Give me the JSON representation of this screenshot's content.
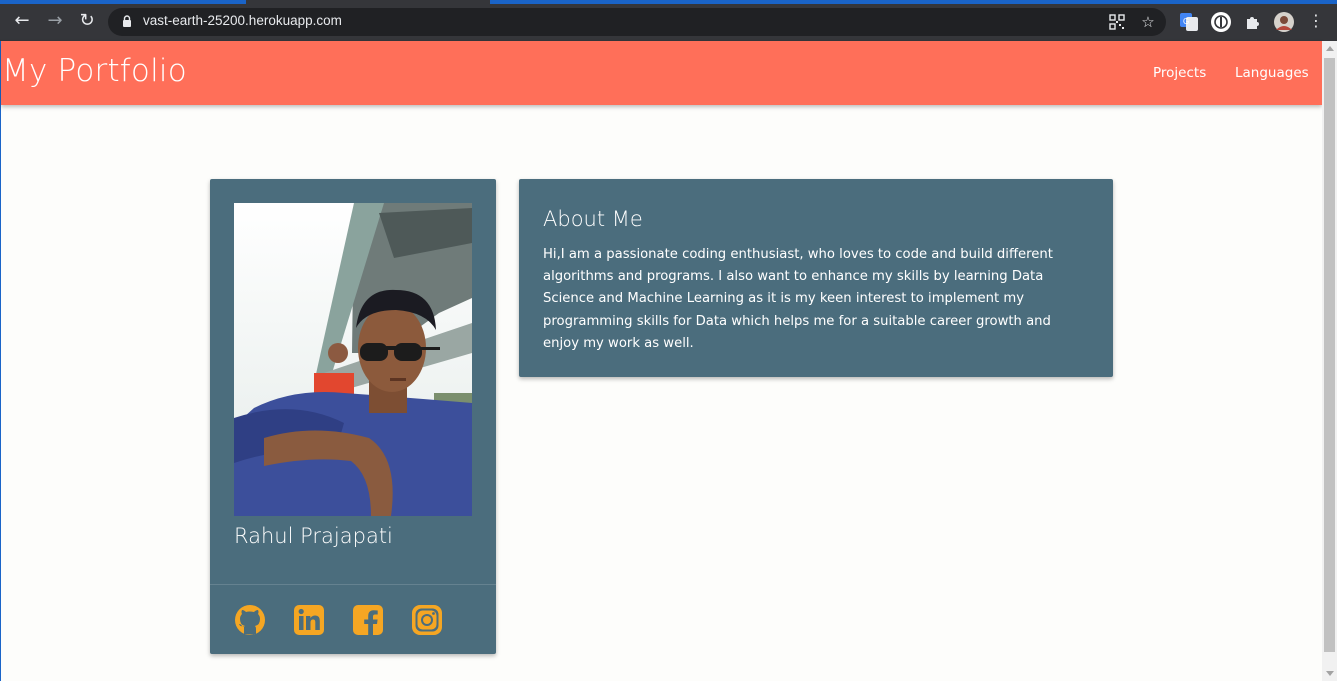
{
  "browser": {
    "url": "vast-earth-25200.herokuapp.com"
  },
  "navbar": {
    "brand": "My Portfolio",
    "links": [
      "Projects",
      "Languages"
    ],
    "color": "#ff6f59"
  },
  "profile": {
    "name": "Rahul Prajapati",
    "social": [
      "github-icon",
      "linkedin-icon",
      "facebook-icon",
      "instagram-icon"
    ],
    "social_color": "#f5a623"
  },
  "about": {
    "title": "About Me",
    "text": "Hi,I am a passionate coding enthusiast, who loves to code and build different algorithms and programs. I also want to enhance my skills by learning Data Science and Machine Learning as it is my keen interest to implement my programming skills for Data which helps me for a suitable career growth and enjoy my work as well."
  },
  "colors": {
    "card": "#4b6d7d",
    "page_bg": "#fdfdfb"
  }
}
